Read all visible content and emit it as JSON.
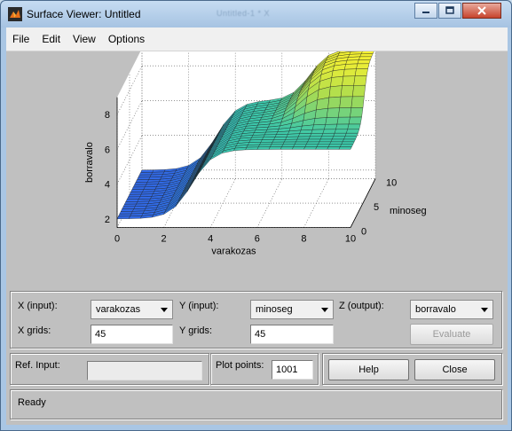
{
  "window": {
    "title": "Surface Viewer: Untitled",
    "background_title": "Untitled-1 * X"
  },
  "menu": [
    "File",
    "Edit",
    "View",
    "Options"
  ],
  "chart_data": {
    "type": "surface",
    "xlabel": "varakozas",
    "ylabel": "minoseg",
    "zlabel": "borravalo",
    "x_ticks": [
      "0",
      "2",
      "4",
      "6",
      "8",
      "10"
    ],
    "y_ticks": [
      "0",
      "5",
      "10"
    ],
    "z_ticks": [
      "2",
      "4",
      "6",
      "8"
    ],
    "xlim": [
      0,
      10
    ],
    "ylim": [
      0,
      10
    ],
    "zlim": [
      1.5,
      9
    ],
    "grid": true,
    "levels": {
      "low": 2,
      "mid": 6,
      "high": 9
    }
  },
  "controls": {
    "x_input_label": "X (input):",
    "x_input_value": "varakozas",
    "y_input_label": "Y (input):",
    "y_input_value": "minoseg",
    "z_output_label": "Z (output):",
    "z_output_value": "borravalo",
    "x_grids_label": "X grids:",
    "x_grids_value": "45",
    "y_grids_label": "Y grids:",
    "y_grids_value": "45",
    "evaluate_label": "Evaluate",
    "ref_input_label": "Ref. Input:",
    "ref_input_value": "",
    "plot_points_label": "Plot points:",
    "plot_points_value": "1001",
    "help_label": "Help",
    "close_label": "Close",
    "status": "Ready"
  }
}
